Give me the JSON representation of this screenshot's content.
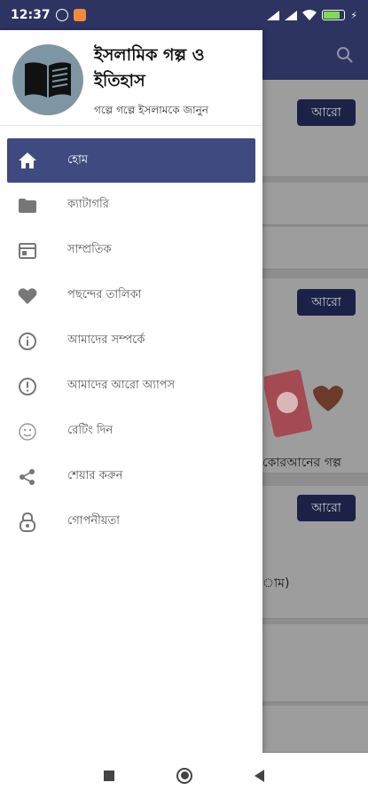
{
  "status_bar": {
    "time": "12:37",
    "battery_level": 0.8,
    "battery_color": "#7fdc4c"
  },
  "background": {
    "more_buttons": [
      "আরো",
      "আরো",
      "আরো"
    ],
    "card_title_partial": "কোরআনের গল্প",
    "list_text_partial": "াম)"
  },
  "drawer": {
    "app_title": "ইসলামিক গল্প ও ইতিহাস",
    "app_subtitle": "গল্পে গল্পে ইসলামকে জানুন",
    "items": [
      {
        "label": "হোম",
        "icon": "home-icon",
        "active": true
      },
      {
        "label": "ক্যাটাগরি",
        "icon": "folder-icon",
        "active": false
      },
      {
        "label": "সাম্প্রতিক",
        "icon": "recent-icon",
        "active": false
      },
      {
        "label": "পছন্দের তালিকা",
        "icon": "heart-icon",
        "active": false
      },
      {
        "label": "আমাদের সম্পর্কে",
        "icon": "info-icon",
        "active": false
      },
      {
        "label": "আমাদের আরো অ্যাপস",
        "icon": "more-apps-icon",
        "active": false
      },
      {
        "label": "রেটিং দিন",
        "icon": "rating-icon",
        "active": false
      },
      {
        "label": "শেয়ার করুন",
        "icon": "share-icon",
        "active": false
      },
      {
        "label": "গোপনীয়তা",
        "icon": "lock-icon",
        "active": false
      }
    ]
  },
  "colors": {
    "primary": "#2d3461",
    "active_item": "#3e4a80"
  }
}
